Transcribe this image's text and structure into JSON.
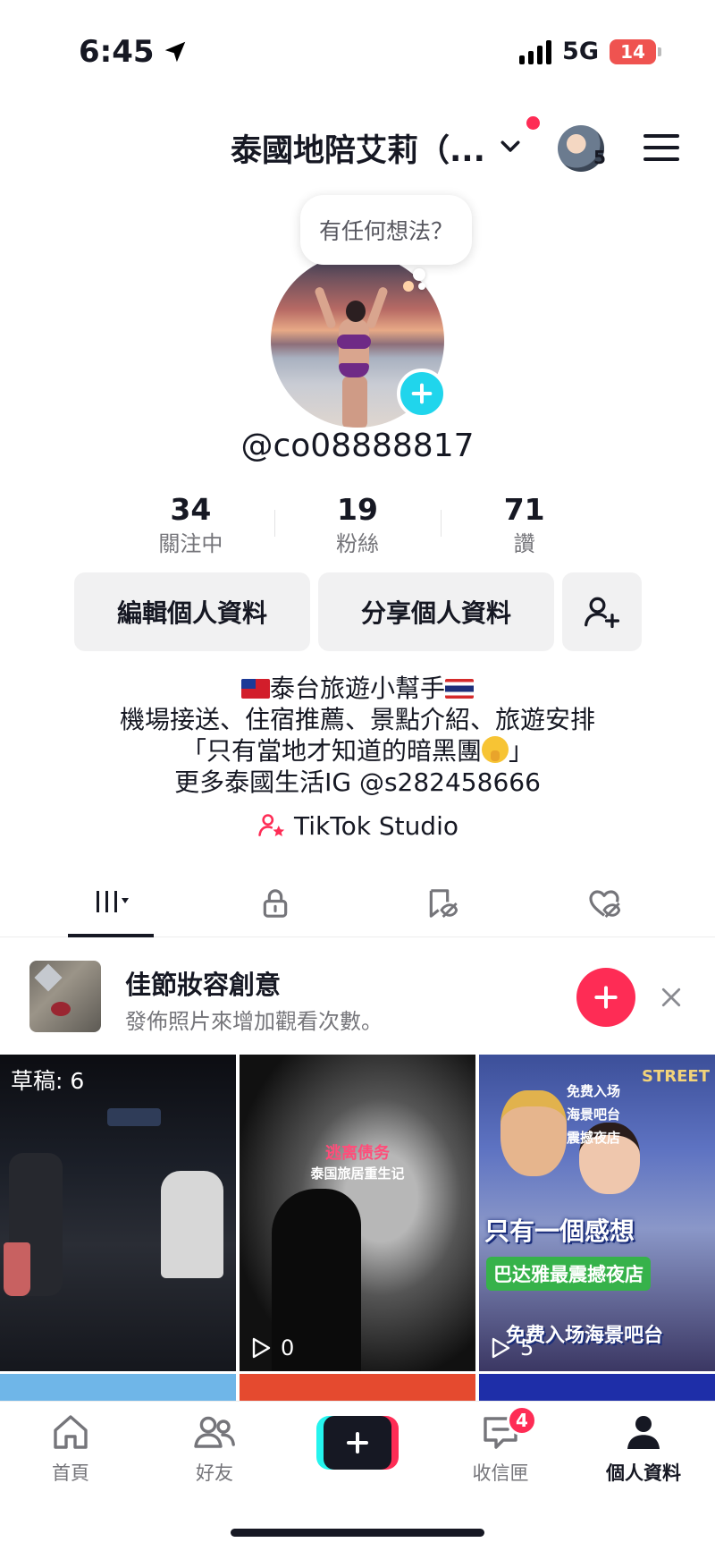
{
  "status_bar": {
    "time": "6:45",
    "network": "5G",
    "battery": "14"
  },
  "header": {
    "account_name": "泰國地陪艾莉（...",
    "switch_count": "5"
  },
  "profile": {
    "bubble_text": "有任何想法？",
    "username": "@co08888817",
    "stats": [
      {
        "value": "34",
        "label": "關注中"
      },
      {
        "value": "19",
        "label": "粉絲"
      },
      {
        "value": "71",
        "label": "讚"
      }
    ],
    "buttons": {
      "edit": "編輯個人資料",
      "share": "分享個人資料"
    },
    "bio": {
      "line1": "泰台旅遊小幫手",
      "line2": "機場接送、住宿推薦、景點介紹、旅遊安排",
      "line3_start": "「只有當地才知道的暗黑團",
      "line3_end": "」",
      "line4": "更多泰國生活IG @s282458666"
    },
    "studio_label": "TikTok Studio"
  },
  "banner": {
    "title": "佳節妝容創意",
    "subtitle": "發佈照片來增加觀看次數。"
  },
  "grid": [
    {
      "drafts": "草稿: 6"
    },
    {
      "views": "0",
      "title": "逃离债务",
      "subtitle": "泰国旅居重生记"
    },
    {
      "views": "5",
      "tags": [
        "免费入场",
        "海景吧台",
        "震撼夜店"
      ],
      "street": "STREET",
      "headline": "只有一個感想",
      "green": "巴达雅最震撼夜店",
      "bottom": "免费入场海景吧台"
    }
  ],
  "bottom_nav": {
    "home": "首頁",
    "friends": "好友",
    "inbox": "收信匣",
    "inbox_badge": "4",
    "profile": "個人資料"
  },
  "colors": {
    "accent": "#fe2c55",
    "cyan": "#20d5ec",
    "text": "#161823",
    "muted": "#75757a"
  }
}
